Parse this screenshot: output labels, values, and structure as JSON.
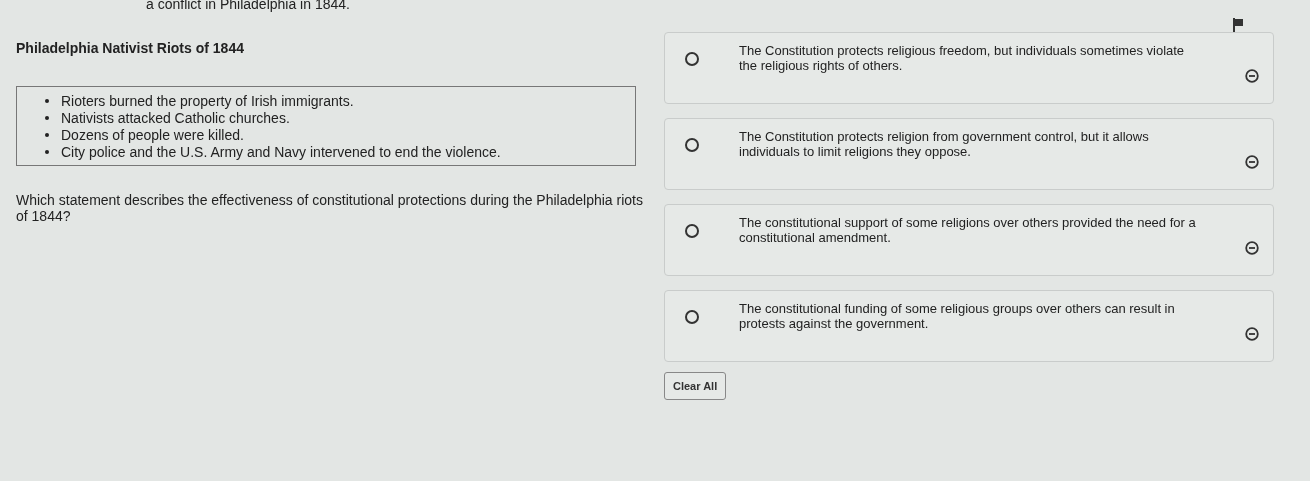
{
  "intro_fragment": "a conflict in Philadelphia in 1844.",
  "source": {
    "title": "Philadelphia Nativist Riots of 1844",
    "bullets": [
      "Rioters burned the property of Irish immigrants.",
      "Nativists attacked Catholic churches.",
      "Dozens of people were killed.",
      "City police and the U.S. Army and Navy intervened to end the violence."
    ]
  },
  "question": "Which statement describes the effectiveness of constitutional protections during the Philadelphia riots of 1844?",
  "options": [
    {
      "text": "The Constitution protects religious freedom, but individuals sometimes violate the religious rights of others.",
      "selected": false
    },
    {
      "text": "The Constitution protects religion from government control, but it allows individuals to limit religions they oppose.",
      "selected": false
    },
    {
      "text": "The constitutional support of some religions over others provided the need for a constitutional amendment.",
      "selected": false
    },
    {
      "text": "The constitutional funding of some religious groups over others can result in protests against the government.",
      "selected": false
    }
  ],
  "clear_button": "Clear All"
}
